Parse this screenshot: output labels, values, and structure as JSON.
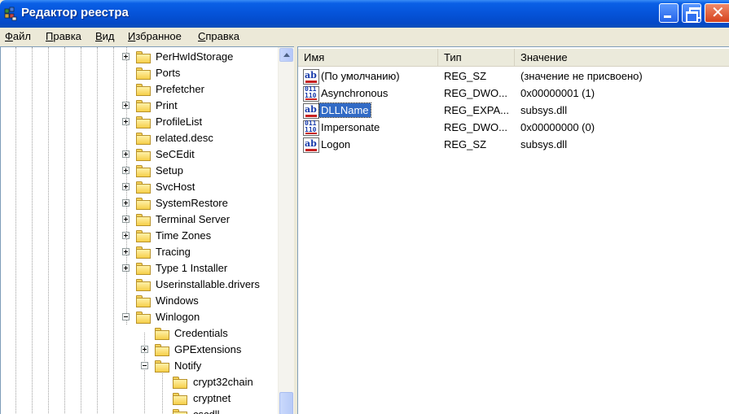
{
  "window": {
    "title": "Редактор реестра",
    "icon": "regedit-icon"
  },
  "menu": [
    {
      "label": "Файл"
    },
    {
      "label": "Правка"
    },
    {
      "label": "Вид"
    },
    {
      "label": "Избранное"
    },
    {
      "label": "Справка"
    }
  ],
  "tree": {
    "items": [
      {
        "label": "PerHwIdStorage",
        "expander": "plus"
      },
      {
        "label": "Ports",
        "expander": "none"
      },
      {
        "label": "Prefetcher",
        "expander": "none"
      },
      {
        "label": "Print",
        "expander": "plus"
      },
      {
        "label": "ProfileList",
        "expander": "plus"
      },
      {
        "label": "related.desc",
        "expander": "none"
      },
      {
        "label": "SeCEdit",
        "expander": "plus"
      },
      {
        "label": "Setup",
        "expander": "plus"
      },
      {
        "label": "SvcHost",
        "expander": "plus"
      },
      {
        "label": "SystemRestore",
        "expander": "plus"
      },
      {
        "label": "Terminal Server",
        "expander": "plus"
      },
      {
        "label": "Time Zones",
        "expander": "plus"
      },
      {
        "label": "Tracing",
        "expander": "plus"
      },
      {
        "label": "Type 1 Installer",
        "expander": "plus"
      },
      {
        "label": "Userinstallable.drivers",
        "expander": "none"
      },
      {
        "label": "Windows",
        "expander": "none"
      },
      {
        "label": "Winlogon",
        "expander": "minus"
      },
      {
        "label": "Credentials",
        "expander": "none"
      },
      {
        "label": "GPExtensions",
        "expander": "plus"
      },
      {
        "label": "Notify",
        "expander": "minus"
      },
      {
        "label": "crypt32chain",
        "expander": "none"
      },
      {
        "label": "cryptnet",
        "expander": "none"
      },
      {
        "label": "cscdll",
        "expander": "none"
      }
    ]
  },
  "list": {
    "columns": [
      "Имя",
      "Тип",
      "Значение"
    ],
    "rows": [
      {
        "name": "(По умолчанию)",
        "type": "REG_SZ",
        "value": "(значение не присвоено)",
        "icon": "string-value-icon"
      },
      {
        "name": "Asynchronous",
        "type": "REG_DWO...",
        "value": "0x00000001 (1)",
        "icon": "binary-value-icon"
      },
      {
        "name": "DLLName",
        "type": "REG_EXPA...",
        "value": "subsys.dll",
        "icon": "string-value-icon",
        "selected": true
      },
      {
        "name": "Impersonate",
        "type": "REG_DWO...",
        "value": "0x00000000 (0)",
        "icon": "binary-value-icon"
      },
      {
        "name": "Logon",
        "type": "REG_SZ",
        "value": "subsys.dll",
        "icon": "string-value-icon"
      }
    ]
  },
  "colors": {
    "titlebar": "#0553d8",
    "selection": "#316ac5",
    "folder": "#f6cf4a"
  }
}
